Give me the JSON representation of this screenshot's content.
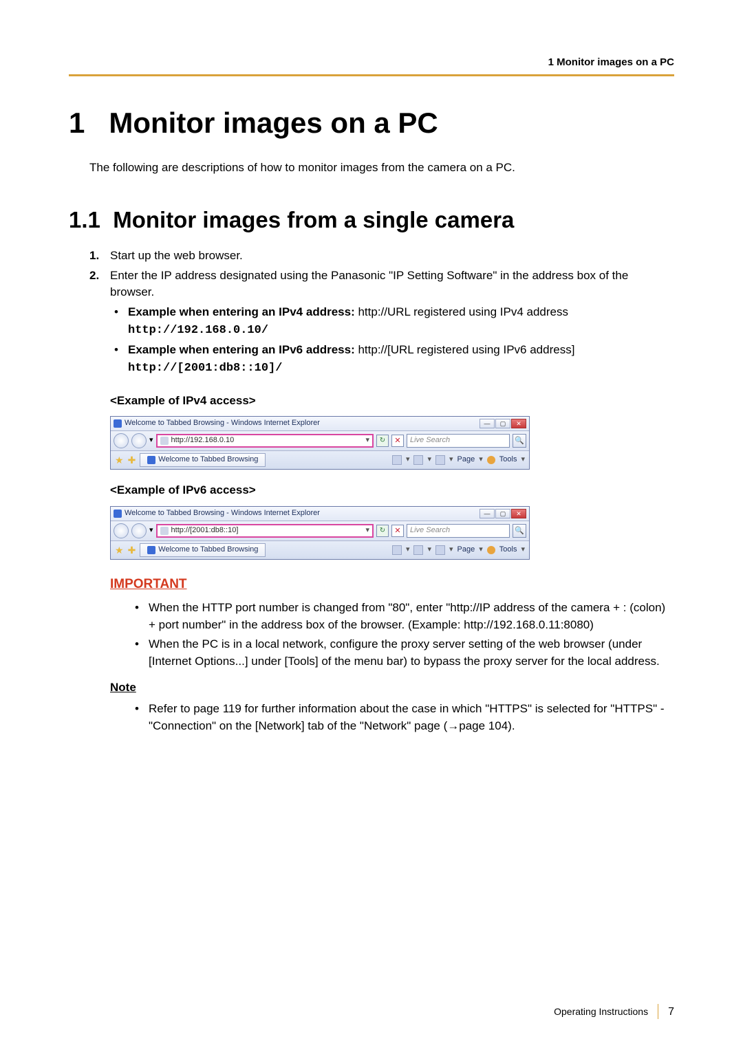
{
  "header": {
    "running": "1 Monitor images on a PC"
  },
  "chapter": {
    "number": "1",
    "title": "Monitor images on a PC"
  },
  "intro": "The following are descriptions of how to monitor images from the camera on a PC.",
  "section": {
    "number": "1.1",
    "title": "Monitor images from a single camera"
  },
  "steps": [
    {
      "n": "1.",
      "text": "Start up the web browser."
    },
    {
      "n": "2.",
      "text": "Enter the IP address designated using the Panasonic \"IP Setting Software\" in the address box of the browser."
    }
  ],
  "examples": [
    {
      "lead_bold": "Example when entering an IPv4 address:",
      "lead_rest": " http://URL registered using IPv4 address",
      "code": "http://192.168.0.10/"
    },
    {
      "lead_bold": "Example when entering an IPv6 address:",
      "lead_rest": " http://[URL registered using IPv6 address]",
      "code": "http://[2001:db8::10]/"
    }
  ],
  "example_headings": {
    "ipv4": "<Example of IPv4 access>",
    "ipv6": "<Example of IPv6 access>"
  },
  "ie_common": {
    "title_prefix": "Welcome to Tabbed Browsing - Windows Internet Explorer",
    "tab_label": "Welcome to Tabbed Browsing",
    "search_placeholder": "Live Search",
    "toolbar_page": "Page",
    "toolbar_tools": "Tools",
    "win_min": "—",
    "win_max": "▢",
    "win_close": "✕",
    "dropdown": "▾",
    "refresh": "↻",
    "stop": "✕",
    "mag": "🔍"
  },
  "ie_ipv4": {
    "url": "http://192.168.0.10"
  },
  "ie_ipv6": {
    "url": "http://[2001:db8::10]"
  },
  "important": {
    "heading": "IMPORTANT",
    "items": [
      "When the HTTP port number is changed from \"80\", enter \"http://IP address of the camera + : (colon) + port number\" in the address box of the browser. (Example: http://192.168.0.11:8080)",
      "When the PC is in a local network, configure the proxy server setting of the web browser (under [Internet Options...] under [Tools] of the menu bar) to bypass the proxy server for the local address."
    ]
  },
  "note": {
    "heading": "Note",
    "items": [
      "Refer to page 119 for further information about the case in which \"HTTPS\" is selected for \"HTTPS\" - \"Connection\" on the [Network] tab of the \"Network\" page (→page 104)."
    ]
  },
  "footer": {
    "label": "Operating Instructions",
    "page": "7"
  }
}
